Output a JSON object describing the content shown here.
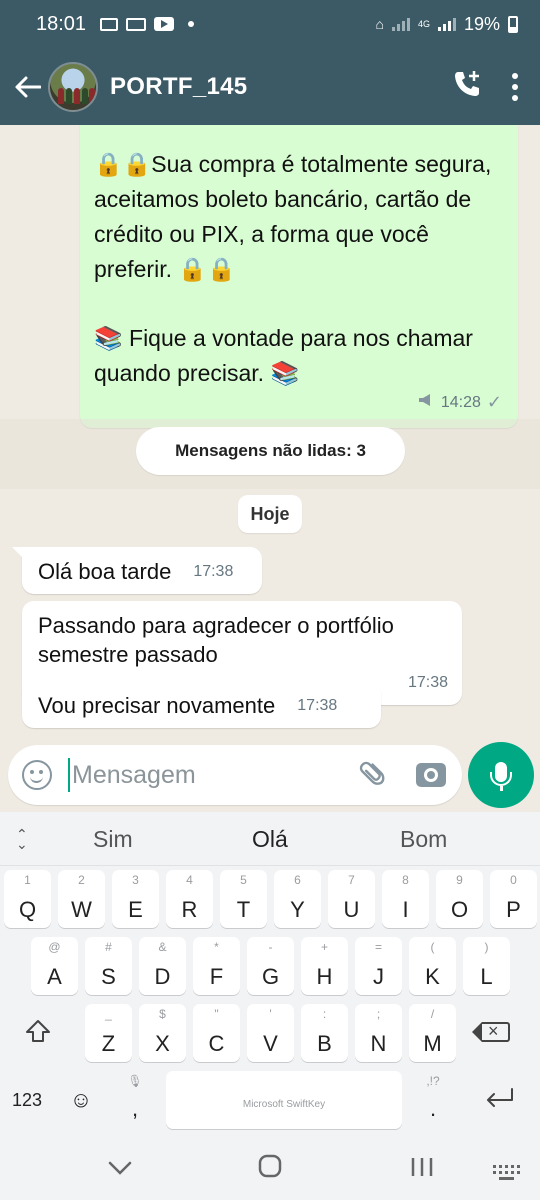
{
  "status_bar": {
    "time": "18:01",
    "network": "4G",
    "battery": "19%"
  },
  "header": {
    "contact_name": "PORTF_145",
    "avatar": "group-photo",
    "icons": [
      "back-arrow-icon",
      "add-call-icon",
      "more-vert-icon"
    ]
  },
  "messages": {
    "outgoing": {
      "line1": "🔒🔒Sua compra é totalmente segura, aceitamos boleto bancário, cartão de crédito ou PIX, a forma que você preferir. 🔒🔒",
      "line2": "📚 Fique a vontade para nos chamar quando precisar. 📚",
      "time": "14:28",
      "status": "✓"
    },
    "unread_banner": "Mensagens não lidas: 3",
    "date_chip": "Hoje",
    "incoming": [
      {
        "text": "Olá boa tarde",
        "time": "17:38"
      },
      {
        "text": "Passando para agradecer o portfólio semestre passado",
        "time": "17:38"
      },
      {
        "text": "Vou precisar novamente",
        "time": "17:38"
      }
    ]
  },
  "composer": {
    "placeholder": "Mensagem",
    "value": ""
  },
  "keyboard": {
    "suggestions": [
      "Sim",
      "Olá",
      "Bom"
    ],
    "row1": [
      {
        "k": "Q",
        "h": "1"
      },
      {
        "k": "W",
        "h": "2"
      },
      {
        "k": "E",
        "h": "3"
      },
      {
        "k": "R",
        "h": "4"
      },
      {
        "k": "T",
        "h": "5"
      },
      {
        "k": "Y",
        "h": "6"
      },
      {
        "k": "U",
        "h": "7"
      },
      {
        "k": "I",
        "h": "8"
      },
      {
        "k": "O",
        "h": "9"
      },
      {
        "k": "P",
        "h": "0"
      }
    ],
    "row2": [
      {
        "k": "A",
        "h": "@"
      },
      {
        "k": "S",
        "h": "#"
      },
      {
        "k": "D",
        "h": "&"
      },
      {
        "k": "F",
        "h": "*"
      },
      {
        "k": "G",
        "h": "-"
      },
      {
        "k": "H",
        "h": "+"
      },
      {
        "k": "J",
        "h": "="
      },
      {
        "k": "K",
        "h": "("
      },
      {
        "k": "L",
        "h": ")"
      }
    ],
    "row3": [
      {
        "k": "Z",
        "h": "_"
      },
      {
        "k": "X",
        "h": "$"
      },
      {
        "k": "C",
        "h": "\""
      },
      {
        "k": "V",
        "h": "'"
      },
      {
        "k": "B",
        "h": ":"
      },
      {
        "k": "N",
        "h": ";"
      },
      {
        "k": "M",
        "h": "/"
      }
    ],
    "numbers_label": "123",
    "comma": ",",
    "period": ".",
    "period_hint": ",!?",
    "space_brand": "Microsoft SwiftKey"
  },
  "navbar": {
    "icons": [
      "nav-back-icon",
      "nav-home-icon",
      "nav-recents-icon",
      "keyboard-switch-icon"
    ]
  }
}
